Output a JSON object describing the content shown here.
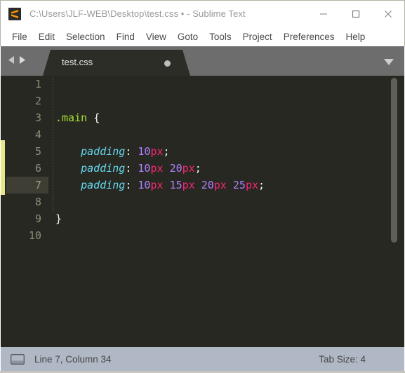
{
  "window": {
    "title": "C:\\Users\\JLF-WEB\\Desktop\\test.css • - Sublime Text",
    "logo_name": "sublime-text-logo",
    "controls": {
      "minimize": "minimize",
      "maximize": "maximize",
      "close": "close"
    }
  },
  "menubar": {
    "items": [
      {
        "label": "File"
      },
      {
        "label": "Edit"
      },
      {
        "label": "Selection"
      },
      {
        "label": "Find"
      },
      {
        "label": "View"
      },
      {
        "label": "Goto"
      },
      {
        "label": "Tools"
      },
      {
        "label": "Project"
      },
      {
        "label": "Preferences"
      },
      {
        "label": "Help"
      }
    ]
  },
  "tabbar": {
    "prev_icon": "arrow-left-icon",
    "next_icon": "arrow-right-icon",
    "dropdown_icon": "chevron-down-icon",
    "tabs": [
      {
        "label": "test.css",
        "modified": true,
        "active": true
      }
    ]
  },
  "editor": {
    "active_line": 7,
    "theme_bg": "#272822",
    "colors": {
      "selector": "#a6e22e",
      "property": "#66d9ef",
      "number": "#ae81ff",
      "unit": "#f92672",
      "punctuation": "#f8f8f2",
      "gutter_text": "#8e8d77",
      "active_gutter_bg": "#3e3e34",
      "marker_yellow": "#e6e68a"
    },
    "line_numbers": [
      "1",
      "2",
      "3",
      "4",
      "5",
      "6",
      "7",
      "8",
      "9",
      "10"
    ],
    "lines": [
      {
        "number": "1",
        "tokens": []
      },
      {
        "number": "2",
        "tokens": []
      },
      {
        "number": "3",
        "tokens": [
          {
            "t": "sel",
            "v": ".main"
          },
          {
            "t": "plain",
            "v": " "
          },
          {
            "t": "punct",
            "v": "{"
          }
        ]
      },
      {
        "number": "4",
        "tokens": []
      },
      {
        "number": "5",
        "tokens": [
          {
            "t": "plain",
            "v": "    "
          },
          {
            "t": "prop",
            "v": "padding"
          },
          {
            "t": "punct",
            "v": ":"
          },
          {
            "t": "plain",
            "v": " "
          },
          {
            "t": "num",
            "v": "10"
          },
          {
            "t": "unit",
            "v": "px"
          },
          {
            "t": "punct",
            "v": ";"
          }
        ]
      },
      {
        "number": "6",
        "tokens": [
          {
            "t": "plain",
            "v": "    "
          },
          {
            "t": "prop",
            "v": "padding"
          },
          {
            "t": "punct",
            "v": ":"
          },
          {
            "t": "plain",
            "v": " "
          },
          {
            "t": "num",
            "v": "10"
          },
          {
            "t": "unit",
            "v": "px"
          },
          {
            "t": "plain",
            "v": " "
          },
          {
            "t": "num",
            "v": "20"
          },
          {
            "t": "unit",
            "v": "px"
          },
          {
            "t": "punct",
            "v": ";"
          }
        ]
      },
      {
        "number": "7",
        "tokens": [
          {
            "t": "plain",
            "v": "    "
          },
          {
            "t": "prop",
            "v": "padding"
          },
          {
            "t": "punct",
            "v": ":"
          },
          {
            "t": "plain",
            "v": " "
          },
          {
            "t": "num",
            "v": "10"
          },
          {
            "t": "unit",
            "v": "px"
          },
          {
            "t": "plain",
            "v": " "
          },
          {
            "t": "num",
            "v": "15"
          },
          {
            "t": "unit",
            "v": "px"
          },
          {
            "t": "plain",
            "v": " "
          },
          {
            "t": "num",
            "v": "20"
          },
          {
            "t": "unit",
            "v": "px"
          },
          {
            "t": "plain",
            "v": " "
          },
          {
            "t": "num",
            "v": "25"
          },
          {
            "t": "unit",
            "v": "px"
          },
          {
            "t": "punct",
            "v": ";"
          }
        ]
      },
      {
        "number": "8",
        "tokens": []
      },
      {
        "number": "9",
        "tokens": [
          {
            "t": "punct",
            "v": "}"
          }
        ]
      },
      {
        "number": "10",
        "tokens": []
      }
    ]
  },
  "statusbar": {
    "icon": "editor-pane-icon",
    "cursor_position": "Line 7, Column 34",
    "tab_size": "Tab Size: 4"
  }
}
